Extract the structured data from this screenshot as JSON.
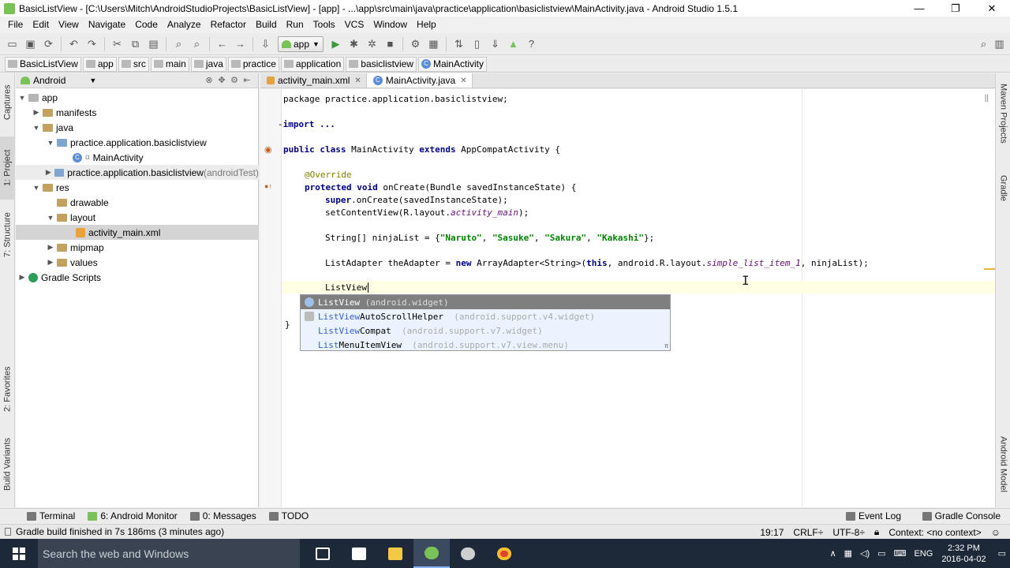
{
  "window": {
    "title": "BasicListView - [C:\\Users\\Mitch\\AndroidStudioProjects\\BasicListView] - [app] - ...\\app\\src\\main\\java\\practice\\application\\basiclistview\\MainActivity.java - Android Studio 1.5.1",
    "minimize": "—",
    "maximize": "❐",
    "close": "✕"
  },
  "menu": [
    "File",
    "Edit",
    "View",
    "Navigate",
    "Code",
    "Analyze",
    "Refactor",
    "Build",
    "Run",
    "Tools",
    "VCS",
    "Window",
    "Help"
  ],
  "toolbar": {
    "run_config": "app",
    "help": "?"
  },
  "breadcrumbs": [
    "BasicListView",
    "app",
    "src",
    "main",
    "java",
    "practice",
    "application",
    "basiclistview",
    "MainActivity"
  ],
  "left_tools": [
    "1: Project",
    "Captures",
    "7: Structure",
    "2: Favorites",
    "Build Variants"
  ],
  "right_tools": [
    "Maven Projects",
    "Gradle",
    "Android Model"
  ],
  "project": {
    "view_mode": "Android",
    "tree": [
      {
        "label": "app",
        "suffix": ""
      },
      {
        "label": "manifests",
        "suffix": ""
      },
      {
        "label": "java",
        "suffix": ""
      },
      {
        "label": "practice.application.basiclistview",
        "suffix": ""
      },
      {
        "label": "MainActivity",
        "suffix": ""
      },
      {
        "label": "practice.application.basiclistview",
        "suffix": " (androidTest)"
      },
      {
        "label": "res",
        "suffix": ""
      },
      {
        "label": "drawable",
        "suffix": ""
      },
      {
        "label": "layout",
        "suffix": ""
      },
      {
        "label": "activity_main.xml",
        "suffix": ""
      },
      {
        "label": "mipmap",
        "suffix": ""
      },
      {
        "label": "values",
        "suffix": ""
      },
      {
        "label": "Gradle Scripts",
        "suffix": ""
      }
    ]
  },
  "editor_tabs": [
    {
      "label": "activity_main.xml",
      "active": false
    },
    {
      "label": "MainActivity.java",
      "active": true
    }
  ],
  "code": {
    "l1": "package practice.application.basiclistview;",
    "l2": "import ...",
    "l3_kw": "public class",
    "l3_rest": " MainActivity ",
    "l3_kw2": "extends",
    "l3_rest2": " AppCompatActivity {",
    "l4": "@Override",
    "l5_kw": "protected void",
    "l5_rest": " onCreate(Bundle savedInstanceState) {",
    "l6_kw": "super",
    "l6_rest": ".onCreate(savedInstanceState);",
    "l7_a": "setContentView(R.layout.",
    "l7_b": "activity_main",
    "l7_c": ");",
    "l8_a": "String[] ninjaList = {",
    "l8_s1": "\"Naruto\"",
    "l8_s2": "\"Sasuke\"",
    "l8_s3": "\"Sakura\"",
    "l8_s4": "\"Kakashi\"",
    "l8_end": "};",
    "l9_a": "ListAdapter theAdapter = ",
    "l9_kw": "new",
    "l9_b": " ArrayAdapter<String>(",
    "l9_kw2": "this",
    "l9_c": ", android.R.layout.",
    "l9_it": "simple_list_item_1",
    "l9_d": ", ninjaList);",
    "l10": "ListView",
    "l11": "}"
  },
  "autocomplete": [
    {
      "match": "ListView",
      "rest": "",
      "pkg": "(android.widget)"
    },
    {
      "match": "ListView",
      "rest": "AutoScrollHelper",
      "pkg": "(android.support.v4.widget)"
    },
    {
      "match": "ListView",
      "rest": "Compat",
      "pkg": "(android.support.v7.widget)"
    },
    {
      "match": "List",
      "rest": "MenuItemView",
      "pkg": "(android.support.v7.view.menu)"
    }
  ],
  "bottom_tools": {
    "terminal": "Terminal",
    "monitor": "6: Android Monitor",
    "messages": "0: Messages",
    "todo": "TODO",
    "event_log": "Event Log",
    "gradle_console": "Gradle Console"
  },
  "status": {
    "message": "Gradle build finished in 7s 186ms (3 minutes ago)",
    "position": "19:17",
    "line_sep": "CRLF÷",
    "encoding": "UTF-8÷",
    "context": "Context: <no context>"
  },
  "taskbar": {
    "search_placeholder": "Search the web and Windows",
    "lang": "ENG",
    "time": "2:32 PM",
    "date": "2016-04-02"
  }
}
